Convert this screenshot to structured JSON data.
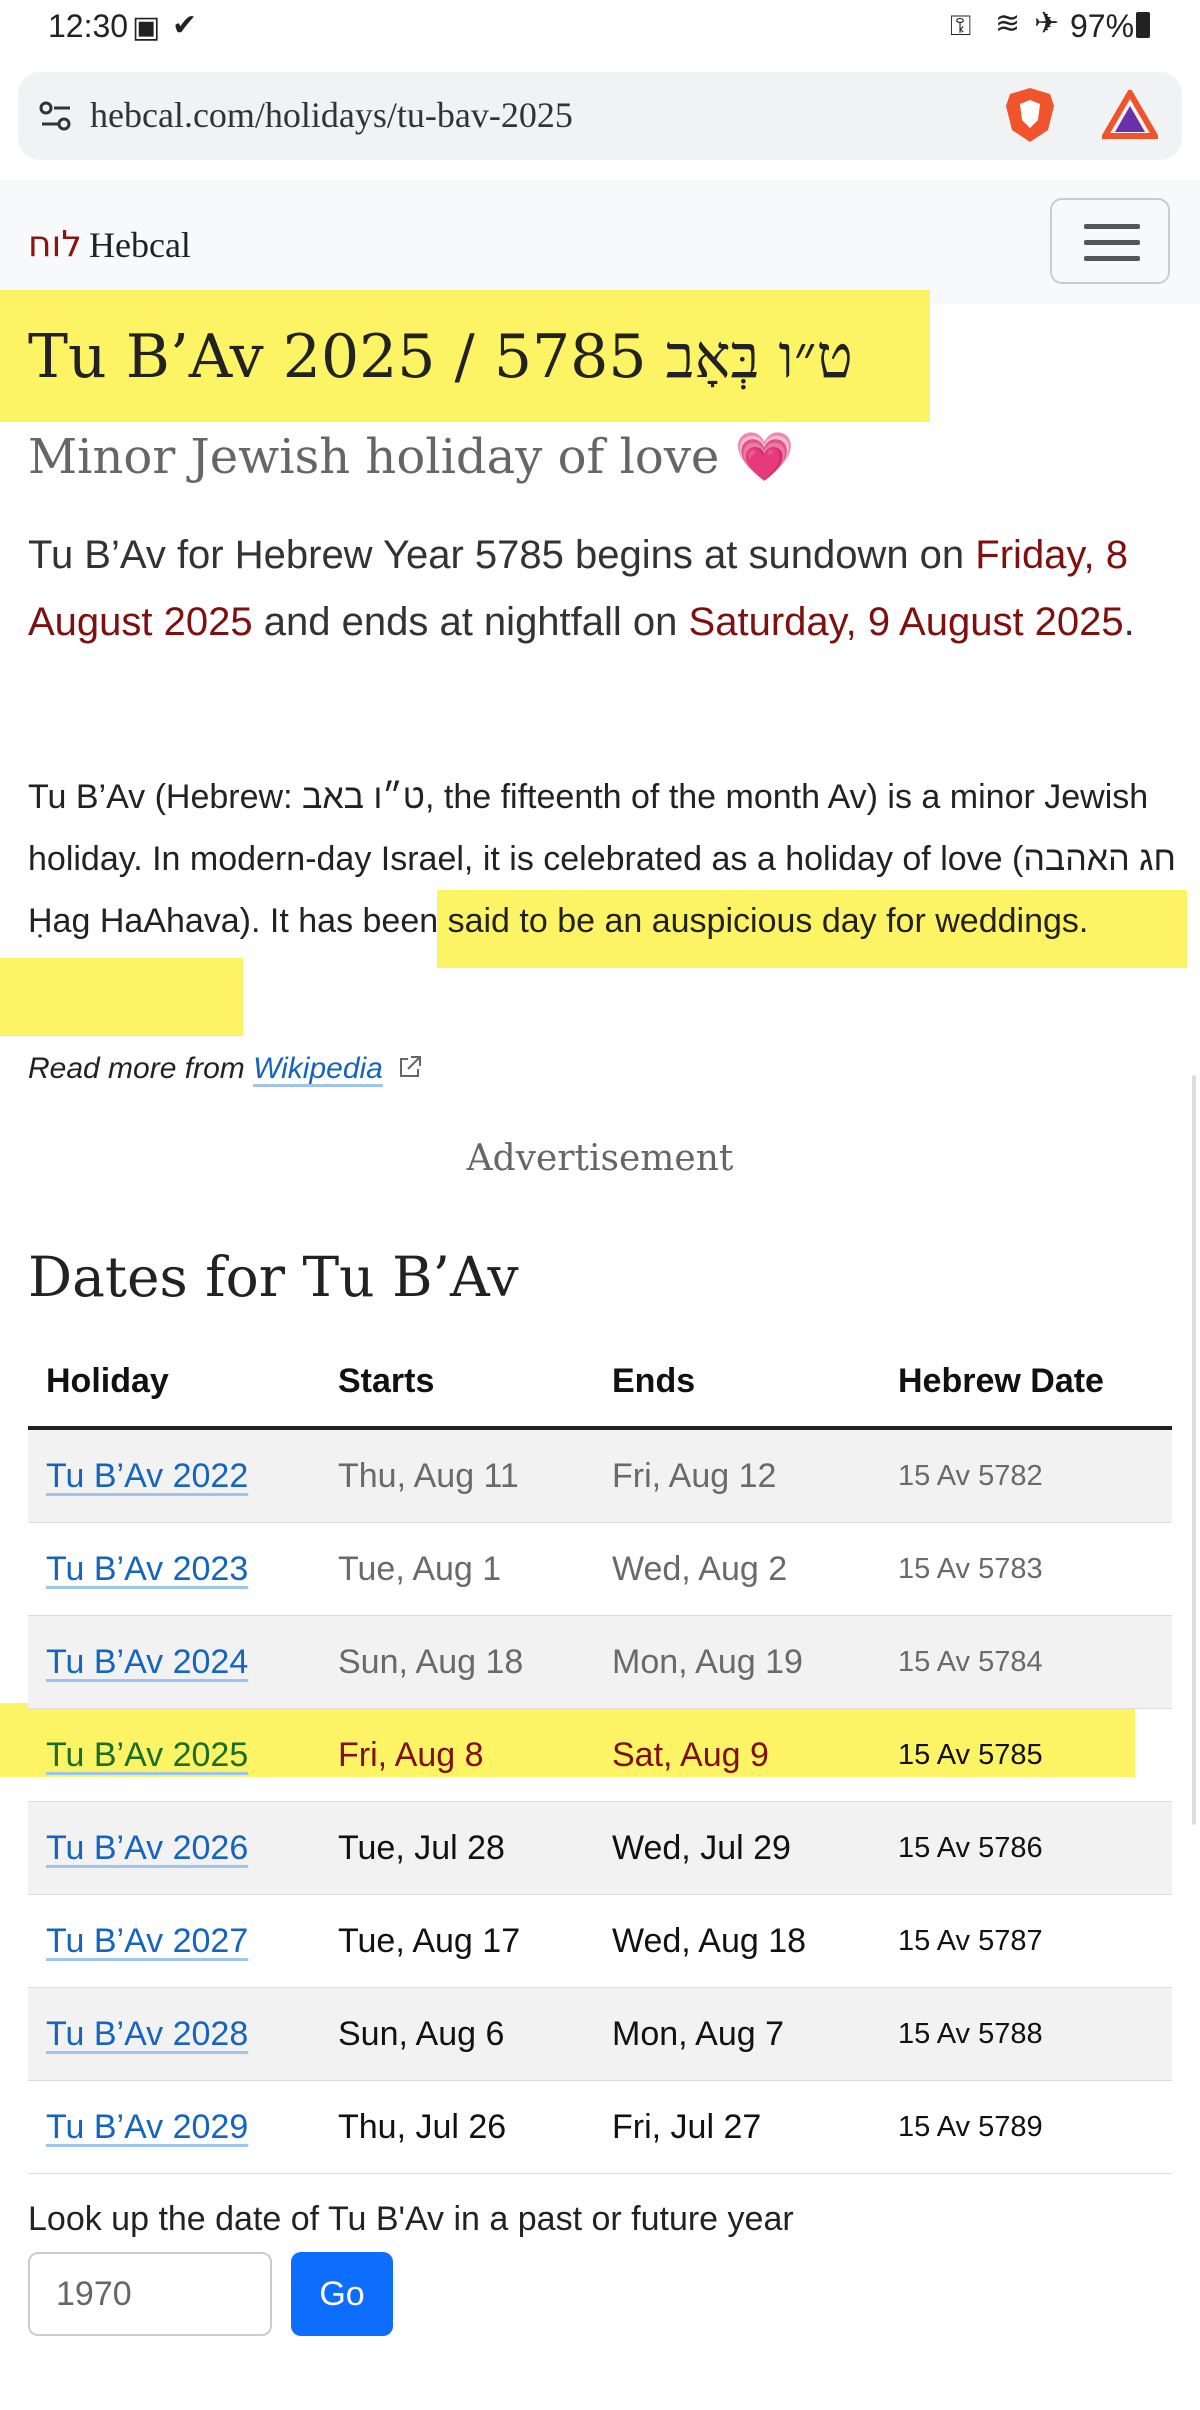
{
  "status_bar": {
    "time": "12:30",
    "battery": "97%"
  },
  "browser": {
    "url": "hebcal.com/holidays/tu-bav-2025"
  },
  "header": {
    "logo_hebrew": "לוח",
    "logo_text": "Hebcal"
  },
  "page": {
    "title": "Tu B’Av 2025 / 5785 ט״ו בְּאָב",
    "subtitle": "Minor Jewish holiday of love 💗",
    "intro_part1": "Tu B’Av for Hebrew Year 5785 begins at sundown on ",
    "start_date": "Friday, 8 August 2025",
    "intro_part2": " and ends at nightfall on ",
    "end_date": "Saturday, 9 August 2025",
    "intro_part3": ".",
    "desc_part1": "Tu B’Av (Hebrew: ט״ו באב, the fifteenth of the month Av) is a minor Jewish holiday. In modern-day Israel, it is celebrated as a holiday of love (חג האהבה Ḥag HaAhava). ",
    "desc_highlight": "It has been said to be an auspicious day for weddings.",
    "read_more_prefix": "Read more from ",
    "read_more_link": "Wikipedia",
    "advertisement": "Advertisement"
  },
  "dates_section": {
    "heading": "Dates for Tu B’Av",
    "columns": [
      "Holiday",
      "Starts",
      "Ends",
      "Hebrew Date"
    ],
    "rows": [
      {
        "holiday": "Tu B’Av 2022",
        "starts": "Thu, Aug 11",
        "ends": "Fri, Aug 12",
        "hebrew": "15 Av 5782"
      },
      {
        "holiday": "Tu B’Av 2023",
        "starts": "Tue, Aug 1",
        "ends": "Wed, Aug 2",
        "hebrew": "15 Av 5783"
      },
      {
        "holiday": "Tu B’Av 2024",
        "starts": "Sun, Aug 18",
        "ends": "Mon, Aug 19",
        "hebrew": "15 Av 5784"
      },
      {
        "holiday": "Tu B’Av 2025",
        "starts": "Fri, Aug 8",
        "ends": "Sat, Aug 9",
        "hebrew": "15 Av 5785"
      },
      {
        "holiday": "Tu B’Av 2026",
        "starts": "Tue, Jul 28",
        "ends": "Wed, Jul 29",
        "hebrew": "15 Av 5786"
      },
      {
        "holiday": "Tu B’Av 2027",
        "starts": "Tue, Aug 17",
        "ends": "Wed, Aug 18",
        "hebrew": "15 Av 5787"
      },
      {
        "holiday": "Tu B’Av 2028",
        "starts": "Sun, Aug 6",
        "ends": "Mon, Aug 7",
        "hebrew": "15 Av 5788"
      },
      {
        "holiday": "Tu B’Av 2029",
        "starts": "Thu, Jul 26",
        "ends": "Fri, Jul 27",
        "hebrew": "15 Av 5789"
      }
    ]
  },
  "lookup": {
    "label": "Look up the date of Tu B'Av in a past or future year",
    "input_value": "1970",
    "button_label": "Go"
  }
}
